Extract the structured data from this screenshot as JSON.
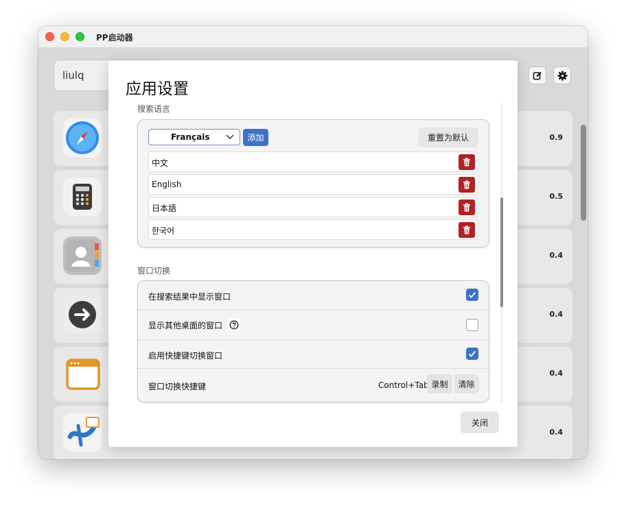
{
  "window": {
    "title": "PP启动器"
  },
  "search": {
    "value": "liulq"
  },
  "apps": [
    {
      "score": "0.9",
      "icon": "safari-icon"
    },
    {
      "score": "0.5",
      "icon": "calculator-icon"
    },
    {
      "score": "0.4",
      "icon": "contacts-icon"
    },
    {
      "score": "0.4",
      "icon": "arrow-right-circle-icon"
    },
    {
      "score": "0.4",
      "icon": "window-app-icon"
    },
    {
      "score": "0.4",
      "icon": "vscode-like-app-icon"
    }
  ],
  "dialog": {
    "title": "应用设置",
    "search_language": {
      "label": "搜索语言",
      "selected": "Français",
      "add_label": "添加",
      "reset_label": "重置为默认",
      "languages": [
        "中文",
        "English",
        "日本語",
        "한국어"
      ]
    },
    "window_switch": {
      "label": "窗口切换",
      "rows": [
        {
          "label": "在搜索结果中显示窗口",
          "checked": true
        },
        {
          "label": "显示其他桌面的窗口",
          "checked": false
        },
        {
          "label": "启用快捷键切换窗口",
          "checked": true
        }
      ],
      "shortcut_label": "窗口切换快捷键",
      "shortcut_value": "Control+Tab",
      "record_label": "录制",
      "clear_label": "清除"
    },
    "close_label": "关闭"
  },
  "colors": {
    "accent": "#3d72c4",
    "danger": "#b32126"
  }
}
